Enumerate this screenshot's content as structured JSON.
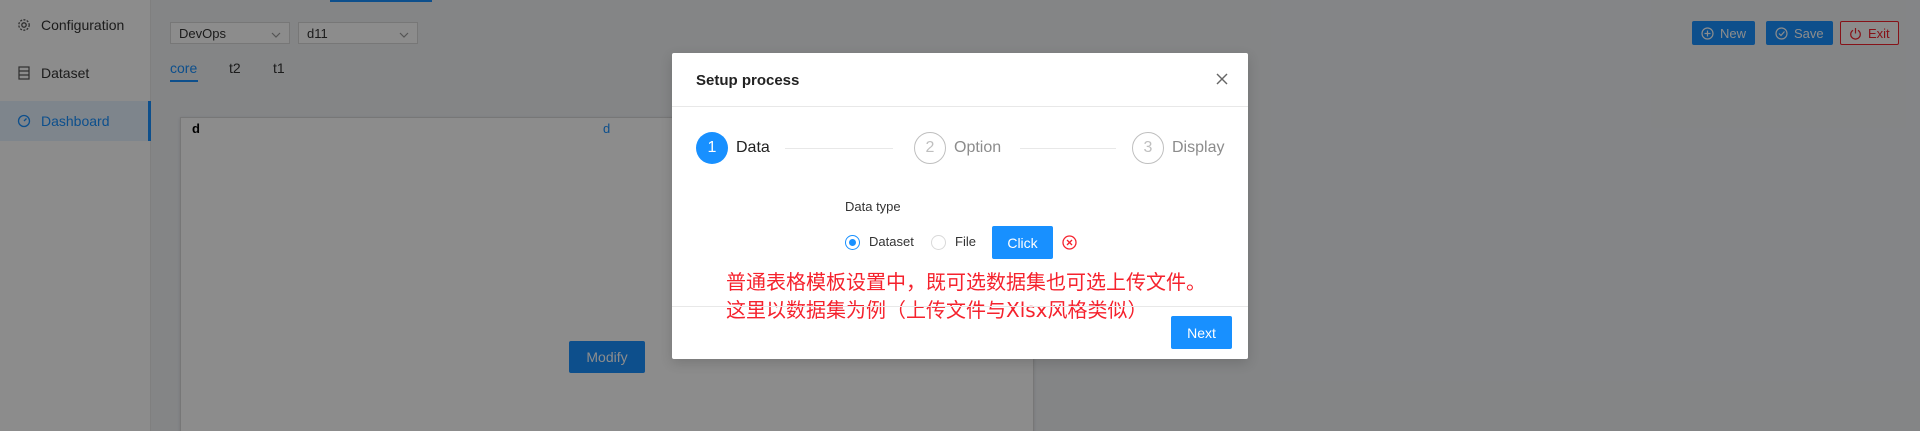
{
  "sidebar": {
    "items": [
      {
        "label": "Configuration",
        "icon": "gear-icon"
      },
      {
        "label": "Dataset",
        "icon": "database-icon"
      },
      {
        "label": "Dashboard",
        "icon": "dashboard-icon",
        "active": true
      }
    ]
  },
  "toolbar": {
    "project_select": "DevOps",
    "dashboard_select": "d11",
    "new_label": "New",
    "save_label": "Save",
    "exit_label": "Exit"
  },
  "tabs": [
    {
      "label": "core",
      "active": true
    },
    {
      "label": "t2"
    },
    {
      "label": "t1"
    }
  ],
  "canvas": {
    "header_left": "d",
    "header_center": "d",
    "modify_label": "Modify"
  },
  "modal": {
    "title": "Setup process",
    "steps": [
      {
        "number": "1",
        "label": "Data",
        "status": "active"
      },
      {
        "number": "2",
        "label": "Option",
        "status": "wait"
      },
      {
        "number": "3",
        "label": "Display",
        "status": "wait"
      }
    ],
    "data_type_label": "Data type",
    "radio_dataset": "Dataset",
    "radio_file": "File",
    "radio_selected": "Dataset",
    "click_label": "Click",
    "annotation_line1": "普通表格模板设置中，既可选数据集也可选上传文件。",
    "annotation_line2": "这里以数据集为例（上传文件与Xlsx风格类似）",
    "next_label": "Next"
  },
  "colors": {
    "primary": "#1890ff",
    "danger": "#f5222d",
    "overlay": "rgba(0,0,0,0.45)"
  }
}
